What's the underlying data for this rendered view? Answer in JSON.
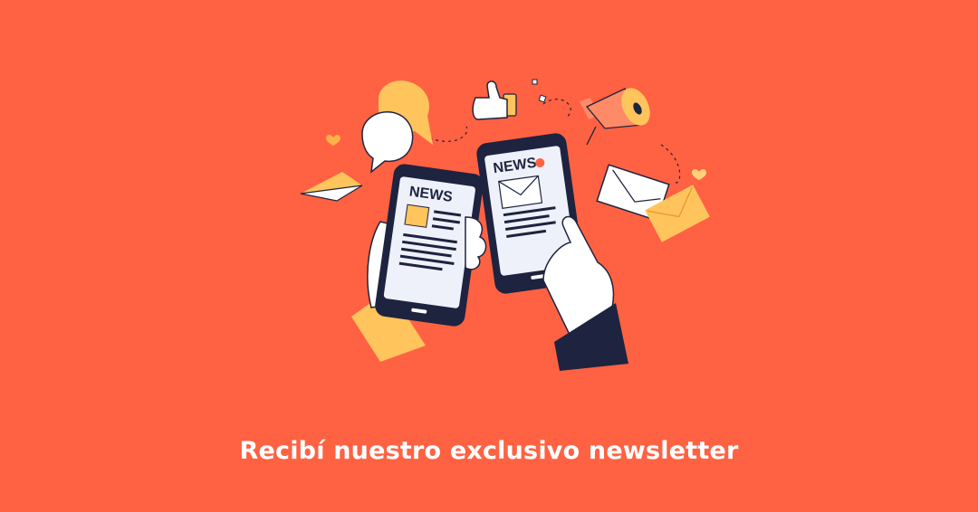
{
  "headline": "Recibí nuestro exclusivo newsletter",
  "phone_left": {
    "label": "NEWS"
  },
  "phone_right": {
    "label": "NEWS"
  },
  "colors": {
    "background": "#FF6242",
    "accent_yellow": "#FFC45C",
    "outline": "#1E2340",
    "screen": "#EEF1FA",
    "text": "#FFFFFF"
  },
  "icons": [
    "speech-bubbles-icon",
    "thumbs-up-icon",
    "megaphone-icon",
    "paper-plane-icon",
    "envelope-icon",
    "heart-icon",
    "hand-icon",
    "smartphone-icon"
  ]
}
